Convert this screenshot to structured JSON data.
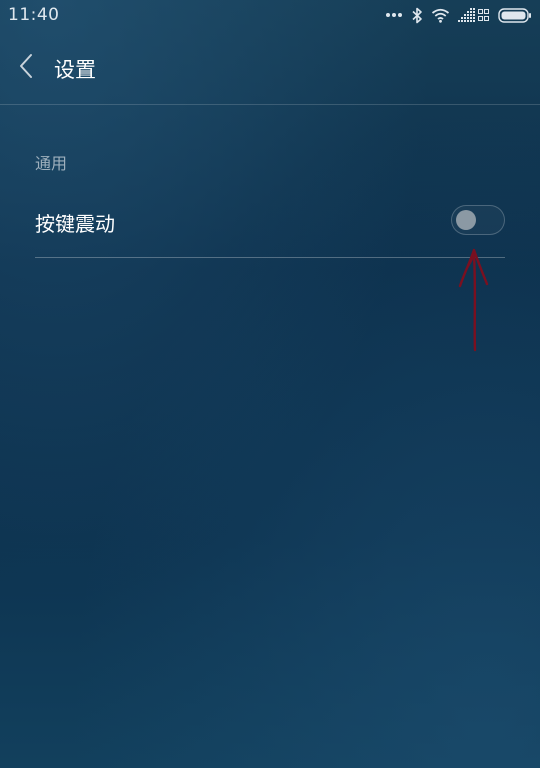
{
  "status_bar": {
    "time": "11:40",
    "icons": [
      "more-dots-icon",
      "bluetooth-icon",
      "wifi-icon",
      "signal-icon",
      "battery-icon"
    ]
  },
  "header": {
    "back_icon": "chevron-left-icon",
    "title": "设置"
  },
  "sections": [
    {
      "label": "通用",
      "items": [
        {
          "label": "按键震动",
          "toggle_on": false
        }
      ]
    }
  ],
  "colors": {
    "background": "#0d3350",
    "text_primary": "#ffffff",
    "text_secondary": "#9fb0bd",
    "toggle_knob_off": "#8b99a4",
    "annotation_arrow": "#7a1020"
  }
}
